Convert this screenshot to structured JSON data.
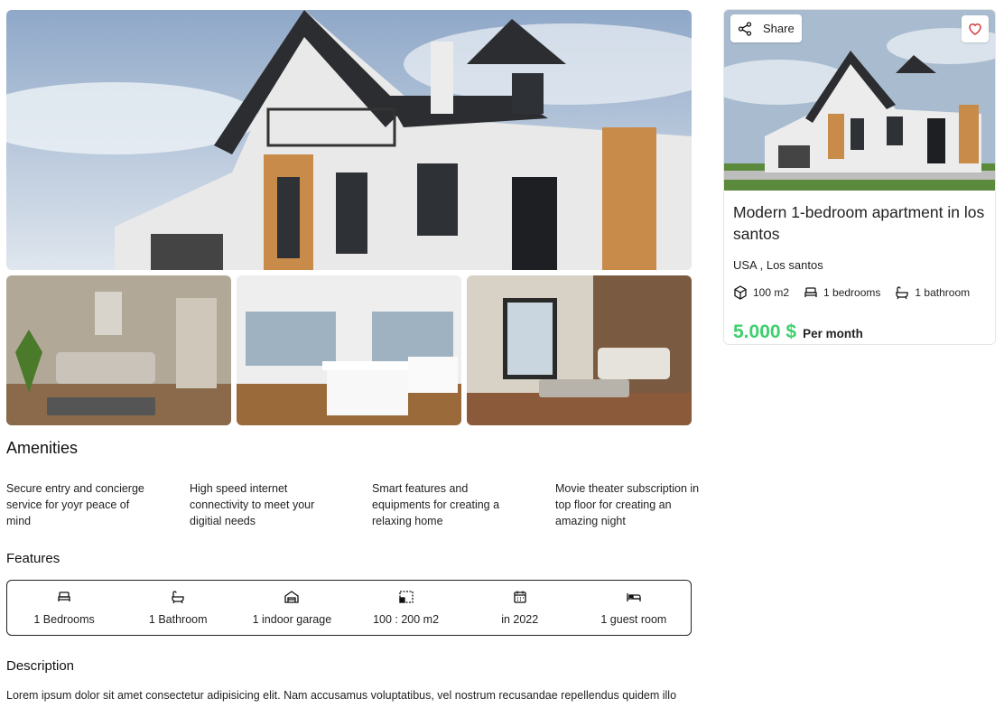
{
  "gallery": {
    "hero_alt": "house exterior",
    "thumbs": [
      "living room",
      "kitchen",
      "lounge"
    ]
  },
  "amenities": {
    "title": "Amenities",
    "items": [
      "Secure entry and concierge service for yoyr peace of mind",
      "High speed internet connectivity to meet your digitial needs",
      "Smart features and equipments for creating a relaxing home",
      "Movie theater subscription in top floor for creating an amazing night"
    ]
  },
  "features": {
    "title": "Features",
    "items": [
      {
        "icon": "bed-icon",
        "label": "1 Bedrooms"
      },
      {
        "icon": "bathtub-icon",
        "label": "1 Bathroom"
      },
      {
        "icon": "garage-icon",
        "label": "1 indoor garage"
      },
      {
        "icon": "area-icon",
        "label": "100 : 200 m2"
      },
      {
        "icon": "calendar-icon",
        "label": "in 2022"
      },
      {
        "icon": "guest-bed-icon",
        "label": "1 guest room"
      }
    ]
  },
  "description": {
    "title": "Description",
    "text": "Lorem ipsum dolor sit amet consectetur adipisicing elit. Nam accusamus voluptatibus, vel nostrum recusandae repellendus quidem illo"
  },
  "card": {
    "share_label": "Share",
    "title": "Modern 1-bedroom apartment in los santos",
    "location": "USA , Los santos",
    "area": "100 m2",
    "bedrooms": "1 bedrooms",
    "bathrooms": "1 bathroom",
    "price": "5.000 $",
    "price_period": "Per month"
  },
  "colors": {
    "price": "#3ecf6e",
    "favorite": "#d23c3c"
  }
}
